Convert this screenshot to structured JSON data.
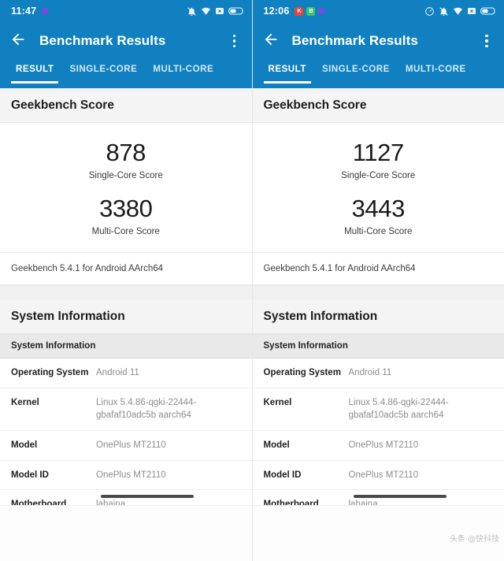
{
  "panels": [
    {
      "statusbar": {
        "time": "11:47",
        "left_badges": [
          {
            "icon": "purple-dot-icon",
            "label": ""
          }
        ],
        "right_icons": [
          "bell-mute-icon",
          "wifi-icon",
          "x-badge-icon",
          "battery-icon"
        ]
      },
      "appbar": {
        "back_icon": "back-arrow-icon",
        "title": "Benchmark Results",
        "menu_icon": "overflow-menu-icon"
      },
      "tabs": [
        {
          "label": "RESULT",
          "active": true
        },
        {
          "label": "SINGLE-CORE",
          "active": false
        },
        {
          "label": "MULTI-CORE",
          "active": false
        }
      ],
      "score_section": {
        "heading": "Geekbench Score",
        "scores": [
          {
            "value": "878",
            "label": "Single-Core Score"
          },
          {
            "value": "3380",
            "label": "Multi-Core Score"
          }
        ],
        "version": "Geekbench 5.4.1 for Android AArch64"
      },
      "system_section": {
        "heading": "System Information",
        "table_header": "System Information",
        "rows": [
          {
            "key": "Operating System",
            "value": "Android 11"
          },
          {
            "key": "Kernel",
            "value": "Linux 5.4.86-qgki-22444-gbafaf10adc5b aarch64"
          },
          {
            "key": "Model",
            "value": "OnePlus MT2110"
          },
          {
            "key": "Model ID",
            "value": "OnePlus MT2110"
          },
          {
            "key": "Motherboard",
            "value": "lahaina"
          }
        ]
      }
    },
    {
      "statusbar": {
        "time": "12:06",
        "left_badges": [
          {
            "icon": "red-app-badge-icon",
            "label": "K"
          },
          {
            "icon": "green-app-badge-icon",
            "label": "B"
          },
          {
            "icon": "purple-dot-icon",
            "label": ""
          }
        ],
        "right_icons": [
          "speedometer-icon",
          "bell-mute-icon",
          "wifi-icon",
          "x-badge-icon",
          "battery-icon"
        ]
      },
      "appbar": {
        "back_icon": "back-arrow-icon",
        "title": "Benchmark Results",
        "menu_icon": "overflow-menu-icon"
      },
      "tabs": [
        {
          "label": "RESULT",
          "active": true
        },
        {
          "label": "SINGLE-CORE",
          "active": false
        },
        {
          "label": "MULTI-CORE",
          "active": false
        }
      ],
      "score_section": {
        "heading": "Geekbench Score",
        "scores": [
          {
            "value": "1127",
            "label": "Single-Core Score"
          },
          {
            "value": "3443",
            "label": "Multi-Core Score"
          }
        ],
        "version": "Geekbench 5.4.1 for Android AArch64"
      },
      "system_section": {
        "heading": "System Information",
        "table_header": "System Information",
        "rows": [
          {
            "key": "Operating System",
            "value": "Android 11"
          },
          {
            "key": "Kernel",
            "value": "Linux 5.4.86-qgki-22444-gbafaf10adc5b aarch64"
          },
          {
            "key": "Model",
            "value": "OnePlus MT2110"
          },
          {
            "key": "Model ID",
            "value": "OnePlus MT2110"
          },
          {
            "key": "Motherboard",
            "value": "lahaina"
          }
        ]
      }
    }
  ],
  "watermark": "头条 @快科技",
  "colors": {
    "appbar_blue": "#1180c0",
    "section_grey": "#f4f4f4",
    "table_header_grey": "#e9e9e9",
    "value_grey": "#8d8d8d"
  }
}
